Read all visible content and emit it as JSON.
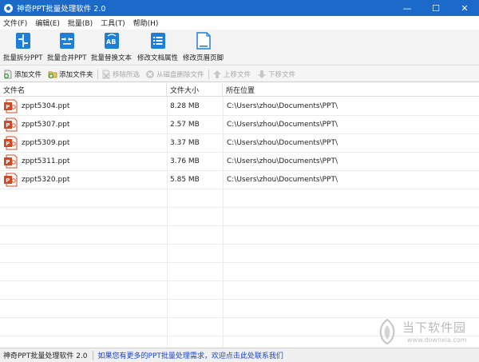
{
  "window": {
    "title": "神奇PPT批量处理软件 2.0",
    "minimize_glyph": "—",
    "maximize_glyph": "☐",
    "close_glyph": "✕"
  },
  "menu": [
    "文件(F)",
    "编辑(E)",
    "批量(B)",
    "工具(T)",
    "帮助(H)"
  ],
  "toolbar": {
    "split": "批量拆分PPT",
    "merge": "批量合并PPT",
    "replace": "批量替换文本",
    "props": "修改文档属性",
    "header_footer": "修改页眉页脚"
  },
  "actions": {
    "add_file": "添加文件",
    "add_folder": "添加文件夹",
    "remove_selected": "移除所选",
    "delete_disk": "从磁盘删除文件",
    "move_up": "上移文件",
    "move_down": "下移文件"
  },
  "columns": {
    "name": "文件名",
    "size": "文件大小",
    "location": "所在位置"
  },
  "files": [
    {
      "name": "zppt5304.ppt",
      "size": "8.28 MB",
      "location": "C:\\Users\\zhou\\Documents\\PPT\\"
    },
    {
      "name": "zppt5307.ppt",
      "size": "2.57 MB",
      "location": "C:\\Users\\zhou\\Documents\\PPT\\"
    },
    {
      "name": "zppt5309.ppt",
      "size": "3.37 MB",
      "location": "C:\\Users\\zhou\\Documents\\PPT\\"
    },
    {
      "name": "zppt5311.ppt",
      "size": "3.76 MB",
      "location": "C:\\Users\\zhou\\Documents\\PPT\\"
    },
    {
      "name": "zppt5320.ppt",
      "size": "5.85 MB",
      "location": "C:\\Users\\zhou\\Documents\\PPT\\"
    }
  ],
  "status": {
    "app": "神奇PPT批量处理软件 2.0",
    "link": "如果您有更多的PPT批量处理需求，欢迎点击此处联系我们"
  },
  "watermark": {
    "name": "当下软件园",
    "url": "www.downxia.com"
  },
  "colors": {
    "titlebar": "#1b6ac9",
    "tool_icon": "#1e7fd8",
    "ppt_icon": "#d24726",
    "add_icon": "#3a9a3a",
    "link": "#1a44c8"
  }
}
